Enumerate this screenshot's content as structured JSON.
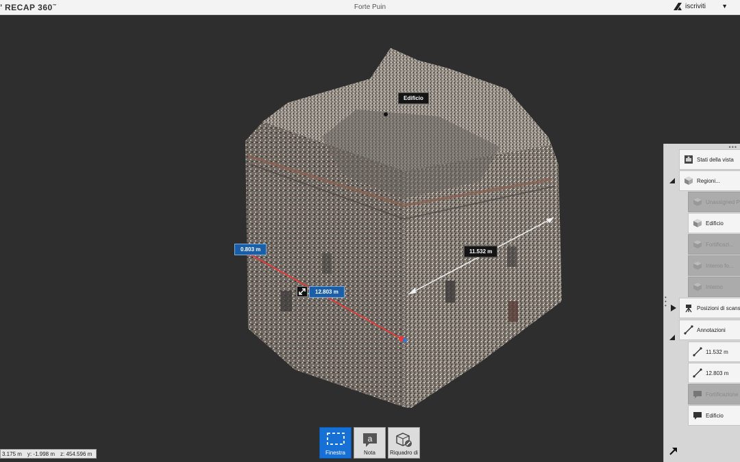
{
  "app": {
    "logo": "RECAP 360",
    "title": "Forte Puin",
    "account_label": "iscriviti"
  },
  "viewport": {
    "labels": {
      "building_tag": "Edificio",
      "measure_a": "11.532 m",
      "measure_b": "12.803 m",
      "measure_c": "0.803 m"
    }
  },
  "panel": {
    "items": [
      {
        "label": "Stati della vista",
        "icon": "camera-view-icon",
        "enabled": true
      },
      {
        "label": "Regioni...",
        "icon": "cube-icon",
        "enabled": true
      },
      {
        "label": "Unassigned Points",
        "icon": "cube-icon",
        "enabled": false
      },
      {
        "label": "Edificio",
        "icon": "cube-icon",
        "enabled": true
      },
      {
        "label": "Fortificazi...",
        "icon": "cube-icon",
        "enabled": false
      },
      {
        "label": "Interno fo...",
        "icon": "cube-icon",
        "enabled": false
      },
      {
        "label": "Interno",
        "icon": "cube-icon",
        "enabled": false
      },
      {
        "label": "Posizioni di scansione",
        "icon": "scan-camera-icon",
        "enabled": true
      },
      {
        "label": "Annotazioni",
        "icon": "measure-line-icon",
        "enabled": true
      },
      {
        "label": "11.532 m",
        "icon": "measure-line-icon",
        "enabled": true
      },
      {
        "label": "12.803 m",
        "icon": "measure-line-icon",
        "enabled": true
      },
      {
        "label": "Fortificazione",
        "icon": "note-bubble-icon",
        "enabled": false
      },
      {
        "label": "Edificio",
        "icon": "note-bubble-icon",
        "enabled": true
      }
    ]
  },
  "toolbar": {
    "window_label": "Finestra",
    "note_label": "Nota",
    "box_label": "Riquadro di"
  },
  "status": {
    "x_label": "x:",
    "x_value": "3.175",
    "x_unit": "m",
    "y_label": "y:",
    "y_value": "-1.998",
    "y_unit": "m",
    "z_label": "z:",
    "z_value": "454.596",
    "z_unit": "m"
  },
  "colors": {
    "accent": "#1670d6",
    "measure_red": "#e23b3b",
    "label_blue": "#1a5ea8"
  }
}
